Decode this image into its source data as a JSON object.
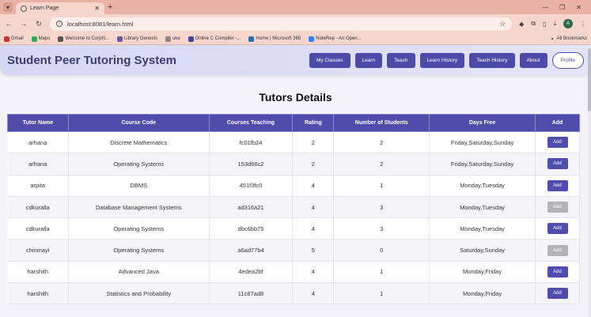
{
  "browser": {
    "tab_title": "Learn Page",
    "url": "localhost:8081/learn.html",
    "bookmarks": [
      {
        "label": "Gmail",
        "color": "#d93025"
      },
      {
        "label": "Maps",
        "color": "#34a853"
      },
      {
        "label": "Welcome to CorpN...",
        "color": "#555555"
      },
      {
        "label": "Library Genesis",
        "color": "#6b5b95"
      },
      {
        "label": "uka",
        "color": "#888888"
      },
      {
        "label": "Online C Compiler -...",
        "color": "#4b3f8f"
      },
      {
        "label": "Home | Microsoft 365",
        "color": "#2b6cb0"
      },
      {
        "label": "NoteRep - An Open...",
        "color": "#3b82f6"
      }
    ],
    "all_bookmarks": "All Bookmarks",
    "avatar_letter": "A"
  },
  "app": {
    "title": "Student Peer Tutoring System",
    "nav": [
      "My Classes",
      "Learn",
      "Teach",
      "Learn History",
      "Teach History",
      "About"
    ],
    "profile": "Profile"
  },
  "page": {
    "title": "Tutors Details"
  },
  "table": {
    "headers": [
      "Tutor Name",
      "Course Code",
      "Courses Teaching",
      "Rating",
      "Number of Students",
      "Days Free",
      "Add"
    ],
    "rows": [
      {
        "tutor": "arhana",
        "course": "Discrete Mathematics",
        "code": "fc01fb24",
        "rating": "2",
        "students": "2",
        "days": "Friday,Saturday,Sunday",
        "add": "Add",
        "disabled": false
      },
      {
        "tutor": "arhana",
        "course": "Operating Systems",
        "code": "153d66c2",
        "rating": "2",
        "students": "2",
        "days": "Friday,Saturday,Sunday",
        "add": "Add",
        "disabled": false
      },
      {
        "tutor": "arpita",
        "course": "DBMS",
        "code": "451f3fc0",
        "rating": "4",
        "students": "1",
        "days": "Monday,Tuesday",
        "add": "Add",
        "disabled": false
      },
      {
        "tutor": "cdkuralla",
        "course": "Database Management Systems",
        "code": "ad316a21",
        "rating": "4",
        "students": "3",
        "days": "Monday,Tuesday",
        "add": "Add",
        "disabled": true
      },
      {
        "tutor": "cdkuralla",
        "course": "Operating Systems",
        "code": "dbc6bb75",
        "rating": "4",
        "students": "3",
        "days": "Monday,Tuesday",
        "add": "Add",
        "disabled": false
      },
      {
        "tutor": "chinmayi",
        "course": "Operating Systems",
        "code": "a6ad77b4",
        "rating": "5",
        "students": "0",
        "days": "Saturday,Sunday",
        "add": "Add",
        "disabled": true
      },
      {
        "tutor": "harshith",
        "course": "Advanced Java",
        "code": "4edea2bf",
        "rating": "4",
        "students": "1",
        "days": "Monday,Friday",
        "add": "Add",
        "disabled": false
      },
      {
        "tutor": "harshith",
        "course": "Statistics and Probability",
        "code": "11c87ad8",
        "rating": "4",
        "students": "1",
        "days": "Monday,Friday",
        "add": "Add",
        "disabled": false
      }
    ]
  }
}
